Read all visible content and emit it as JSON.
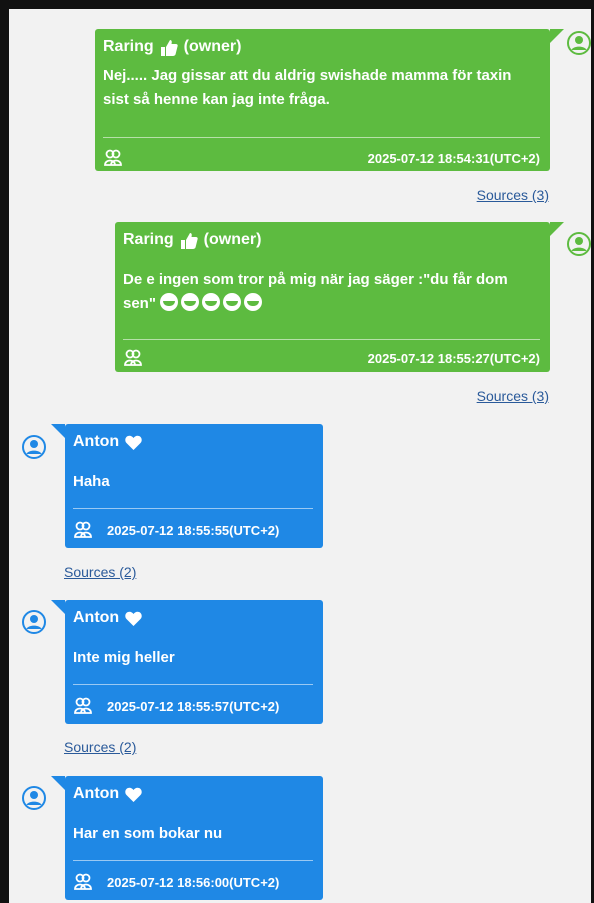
{
  "colors": {
    "outgoing": "#5dbb40",
    "incoming": "#1f88e5",
    "link": "#2a5a9a"
  },
  "messages": [
    {
      "sender": "Raring",
      "role": "(owner)",
      "sender_icon": "thumbs-up-icon",
      "text": "Nej..... Jag gissar att du aldrig swishade mamma för taxin sist så henne kan jag inte fråga.",
      "timestamp": "2025-07-12 18:54:31(UTC+2)",
      "sources": "Sources (3)"
    },
    {
      "sender": "Raring",
      "role": "(owner)",
      "sender_icon": "thumbs-up-icon",
      "text": "De e ingen som tror på mig när jag säger :\"du får dom sen\"",
      "emoji_count": 5,
      "timestamp": "2025-07-12 18:55:27(UTC+2)",
      "sources": "Sources (3)"
    },
    {
      "sender": "Anton",
      "sender_icon": "heart-icon",
      "text": "Haha",
      "timestamp": "2025-07-12 18:55:55(UTC+2)",
      "sources": "Sources (2)"
    },
    {
      "sender": "Anton",
      "sender_icon": "heart-icon",
      "text": "Inte mig heller",
      "timestamp": "2025-07-12 18:55:57(UTC+2)",
      "sources": "Sources (2)"
    },
    {
      "sender": "Anton",
      "sender_icon": "heart-icon",
      "text": "Har en som bokar nu",
      "timestamp": "2025-07-12 18:56:00(UTC+2)"
    }
  ]
}
